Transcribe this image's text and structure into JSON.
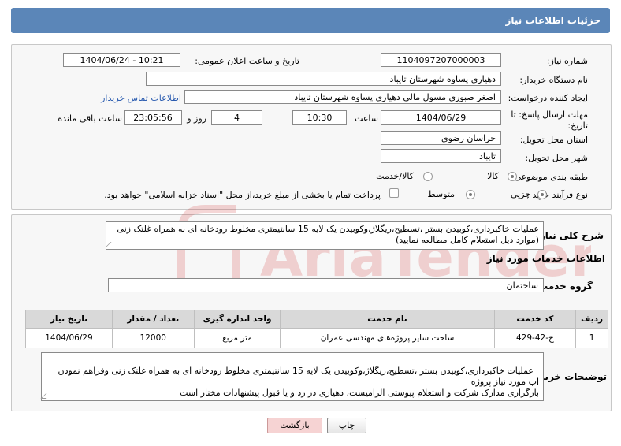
{
  "header": {
    "title": "جزئیات اطلاعات نیاز"
  },
  "fields": {
    "need_number_label": "شماره نیاز:",
    "need_number": "1104097207000003",
    "announce_label": "تاریخ و ساعت اعلان عمومی:",
    "announce_value": "1404/06/24 - 10:21",
    "buyer_org_label": "نام دستگاه خریدار:",
    "buyer_org": "دهیاری پساوه  شهرستان تایباد",
    "creator_label": "ایجاد کننده درخواست:",
    "creator": "اصغر صبوری مسول مالی دهیاری پساوه  شهرستان تایباد",
    "contact_link": "اطلاعات تماس خریدار",
    "deadline_label": "مهلت ارسال پاسخ: تا تاریخ:",
    "deadline_date": "1404/06/29",
    "time_label": "ساعت",
    "deadline_time": "10:30",
    "days_value": "4",
    "days_label": "روز و",
    "remaining_time": "23:05:56",
    "remaining_label": "ساعت باقی مانده",
    "province_label": "استان محل تحویل:",
    "province": "خراسان رضوی",
    "city_label": "شهر محل تحویل:",
    "city": "تایباد",
    "category_label": "طبقه بندی موضوعی:",
    "category_options": [
      "کالا",
      "کالا/خدمت"
    ],
    "process_label": "نوع فرآیند خرید :",
    "process_options": [
      "جزیی",
      "متوسط"
    ],
    "payment_note": "پرداخت تمام یا بخشی از مبلغ خرید،از محل \"اسناد خزانه اسلامی\" خواهد بود."
  },
  "summary": {
    "label": "شرح کلی نیاز:",
    "text": "عملیات خاکبرداری،کوبیدن بستر ،تسطیح،ریگلاژ،وکوبیدن یک لایه 15 سانتیمتری مخلوط رودخانه ای به همراه غلتک زنی  (موارد ذیل استعلام کامل  مطالعه نمایید)"
  },
  "services": {
    "section_title": "اطلاعات خدمات مورد نیاز",
    "group_label": "گروه خدمت:",
    "group_value": "ساختمان",
    "columns": [
      "ردیف",
      "کد خدمت",
      "نام خدمت",
      "واحد اندازه گیری",
      "تعداد / مقدار",
      "تاریخ نیاز"
    ],
    "rows": [
      [
        "1",
        "ج-42-429",
        "ساخت سایر پروژه‌های مهندسی عمران",
        "متر مربع",
        "12000",
        "1404/06/29"
      ]
    ]
  },
  "buyer_notes": {
    "label": "توضیحات خریدار:",
    "text": "عملیات خاکبرداری،کوبیدن بستر ،تسطیح،ریگلاژ،وکوبیدن یک لایه 15 سانتیمتری مخلوط رودخانه ای به همراه غلتک زنی وفراهم نمودن اب مورد نیاز پروژه\nبارگزاری مدارک شرکت و استعلام پیوستی الزامیست، دهیاری در رد و یا قبول پیشنهادات مختار است"
  },
  "buttons": {
    "print": "چاپ",
    "back": "بازگشت"
  },
  "watermark": "AriaTender.net",
  "colors": {
    "header": "#5b86b8",
    "link": "#2b5cb0",
    "back_button": "#f6d3d3"
  }
}
